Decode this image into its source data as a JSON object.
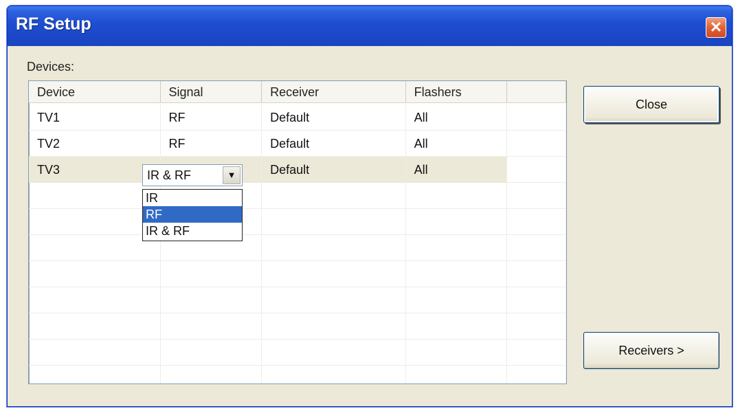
{
  "window": {
    "title": "RF Setup",
    "close_glyph": "✕"
  },
  "devices_label": "Devices:",
  "columns": [
    "Device",
    "Signal",
    "Receiver",
    "Flashers",
    ""
  ],
  "rows": [
    {
      "device": "TV1",
      "signal": "RF",
      "receiver": "Default",
      "flashers": "All"
    },
    {
      "device": "TV2",
      "signal": "RF",
      "receiver": "Default",
      "flashers": "All"
    },
    {
      "device": "TV3",
      "signal": "IR & RF",
      "receiver": "Default",
      "flashers": "All"
    }
  ],
  "signal_combo": {
    "value": "IR & RF",
    "arrow": "▼",
    "options": [
      "IR",
      "RF",
      "IR & RF"
    ],
    "highlighted": "RF"
  },
  "buttons": {
    "close": "Close",
    "receivers": "Receivers >"
  },
  "colors": {
    "title_bar": "#1f4fd2",
    "selection": "#316ac5",
    "dialog_bg": "#ece9d8"
  }
}
